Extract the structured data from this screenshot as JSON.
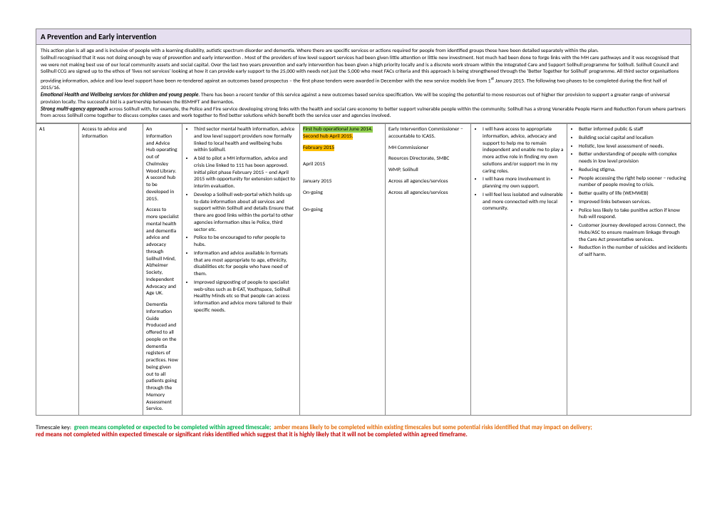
{
  "header": {
    "title": "A Prevention and Early intervention"
  },
  "intro": {
    "p1": "This action plan is all age and is inclusive of people with a learning disability, autistic spectrum disorder and dementia.  Where there are specific services or actions required for people from identified groups these have been detailed separately  within the plan.",
    "p2a": "Solihull recognised that it was not doing enough by way of prevention and early intervention . Most of the providers of low level support services had been given little attention or little new investment.  Not much had been done to forge links with the MH care pathways and it was recognised that we were not making best use of our local community assets and social capital.  Over the last two years prevention and early intervention has been given a high priority locally and is a discrete work stream within the Integrated Care and Support Solihull programme for Solihull.  Solihull Council and Solihull CCG are signed up to the ethos of 'lives not services' looking at how it can provide early support to the 25,000 with needs not just the 5,000 who meet FACs criteria  and this approach is being strengthened through the 'Better Together for Solihull' programme.  All third sector organisations providing information, advice and low level support have been re-tendered against an outcomes based prospectus – the first phase tenders were awarded in December with the new service models live from 1",
    "p2sup": "st",
    "p2b": " January 2015.  The following two phases to be completed during the first half of 2015/16.",
    "p3label": "Emotional Health and Wellbeing services for children and young people",
    "p3text": ".  There has been a recent tender of this service against a new outcomes based service specification.  We will be scoping the potential to move resources out of higher tier provision to support a greater range of universal provision locally.  The successful bid is a partnership between the BSMHFT and Bernardos.",
    "p4label": "Strong multi-agency approach",
    "p4text": " across Solihull with, for example, the Police and Fire service developing strong links with the health and social care economy to better support vulnerable people within the community.  Solihull has a strong Venerable People Harm and Reduction Forum where partners from across Solihull come together to discuss complex cases and work together to find better solutions which benefit both the service user and agencies involved."
  },
  "row": {
    "a1": "A1",
    "access": "Access to advice and information",
    "hub_p1": "An Information and Advice Hub operating out of Chelmsley Wood Library. A second hub to be developed in 2015.",
    "hub_p2": "Access to more specialist mental health and dementia advice and advocacy through Solihull Mind, Alzheimer Society, Independent Advocacy and Age UK.",
    "hub_p3": "Dementia Information Guide Produced and offered to all people on the dementia registers of practices. Now being given out to all patients going through the Memory Assessment Service.",
    "actions": [
      "Third sector mental health information, advice and low level support providers now formally linked to local health and wellbeing hubs within Solihull.",
      "A bid to pilot a MH information, advice and crisis Line linked to 111 has been approved. Initial pilot phase February 2015 – end April 2015 with opportunity for extension subject to interim evaluation.",
      "Develop a Solihull  web-portal which holds up to date information about all services and support within Solihull and details   Ensure that there are good links within the portal to other agencies information sites ie Police, third sector etc.",
      "Police to be encouraged to refer people to hubs.",
      "Information and advice available in formats that are most appropriate to age, ethnicity, disabilities etc for people who have need of them.",
      "Improved signposting of people to specialist web-sites such as B-EAT, Youthspace, Solihull Healthy Minds etc so that people can access information and advice more tailored to their specific needs."
    ],
    "timescale": {
      "green": "First hub operational June 2014.",
      "amber": "Second hub April 2015.",
      "feb": "February 2015",
      "apr": "April 2015",
      "jan": "January 2015",
      "ongoing1": "On-going",
      "ongoing2": "On-going"
    },
    "leads": [
      "Early Intervention Commissioner – accountable to ICASS.",
      "MH Commissioner",
      "Reources Directorate, SMBC",
      "WMP, Solihull",
      "Across all agencies/services",
      "Across all agencies/services"
    ],
    "individual": [
      "I will have access to appropriate information, advice, advocacy and support to help me to remain independent and enable me to play a more active role in finding my own solutions and/or support me in my caring roles.",
      "I will have more involvement in planning my own support.",
      "I will feel less isolated and vulnerable and more connected with my local community."
    ],
    "outcomes": [
      "Better informed public & staff",
      "Building social capital and localism",
      "Holistic, low level assessment of needs.",
      "Better understanding of people with complex needs in low level provision",
      "Reducing stigma.",
      "People accessing the right help sooner – reducing number of people moving to crisis.",
      "Better quality of life (WEMWEB)",
      "Improved links between services.",
      "Police less likely to take punitive action if know hub will respond.",
      "Customer journey developed across Connect, the Hubs/ASC to ensure maximum linkage through the Care Act preventative services.",
      "Reduction in the number of suicides and incidents of self harm."
    ]
  },
  "key": {
    "prefix": "Timescale key:",
    "green": "green means completed or expected to be completed within agreed timescale;",
    "amber": "amber means likely to be completed within existing timescales but some potential risks identified that may impact on delivery;",
    "red": "red means not completed within expected timescale or significant risks identified which suggest that it is highly likely that it will not be completed within agreed timeframe."
  }
}
